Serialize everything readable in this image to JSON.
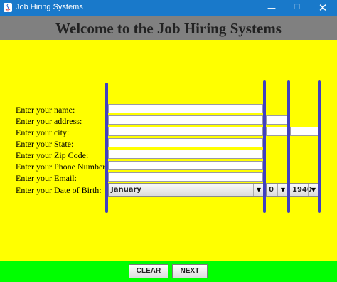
{
  "window": {
    "title": "Job Hiring Systems",
    "minimize": "—",
    "maximize": "☐",
    "close": "✕"
  },
  "header": {
    "title": "Welcome to the Job Hiring Systems"
  },
  "form": {
    "labels": {
      "name": "Enter your name:",
      "address": "Enter your address:",
      "city": "Enter your city:",
      "state": "Enter your State:",
      "zip": "Enter your Zip Code:",
      "phone": "Enter your Phone Number:",
      "email": "Enter your Email:",
      "dob": "Enter your Date of Birth:"
    },
    "fields": {
      "name": "",
      "address": "",
      "city": "",
      "state": "",
      "zip": "",
      "phone": "",
      "email": ""
    },
    "dob": {
      "month": "January",
      "day": "0",
      "year": "1940"
    }
  },
  "buttons": {
    "clear": "CLEAR",
    "next": "NEXT"
  },
  "icons": {
    "app": "java-app-icon",
    "dropdown": "chevron-down-icon"
  },
  "colors": {
    "background": "#ffff00",
    "header": "#808080",
    "footer": "#00ff00",
    "titlebar": "#1979ca",
    "separator": "#4040c0"
  }
}
